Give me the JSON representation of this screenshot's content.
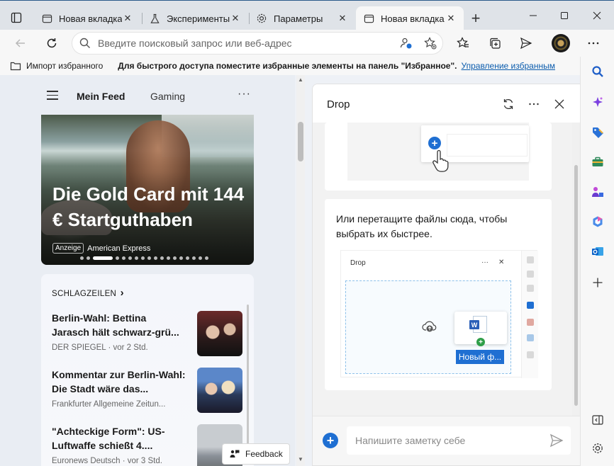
{
  "tabs": [
    {
      "label": "Новая вкладка",
      "icon": "newtab-icon"
    },
    {
      "label": "Эксперименты",
      "icon": "flask-icon"
    },
    {
      "label": "Параметры",
      "icon": "gear-icon"
    },
    {
      "label": "Новая вкладка",
      "icon": "newtab-icon",
      "active": true
    }
  ],
  "address": {
    "placeholder": "Введите поисковый запрос или веб-адрес"
  },
  "favorites_bar": {
    "import_label": "Импорт избранного",
    "hint": "Для быстрого доступа поместите избранные элементы на панель \"Избранное\".",
    "manage_link": "Управление избранным"
  },
  "feed": {
    "tabs": [
      "Mein Feed",
      "Gaming"
    ],
    "more": "···",
    "hero": {
      "title": "Die Gold Card mit 144 € Startguthaben",
      "ad_badge": "Anzeige",
      "source": "American Express"
    },
    "headlines_label": "SCHLAGZEILEN",
    "headlines_chevron": "›",
    "news": [
      {
        "title": "Berlin-Wahl: Bettina Jarasch hält schwarz-grü...",
        "meta": "DER SPIEGEL · vor 2 Std."
      },
      {
        "title": "Kommentar zur Berlin-Wahl: Die Stadt wäre das...",
        "meta": "Frankfurter Allgemeine Zeitun..."
      },
      {
        "title": "\"Achteckige Form\": US-Luftwaffe schießt 4....",
        "meta": "Euronews Deutsch · vor 3 Std."
      }
    ],
    "feedback_label": "Feedback"
  },
  "drop": {
    "title": "Drop",
    "drag_text": "Или перетащите файлы сюда, чтобы выбрать их быстрее.",
    "mini_title": "Drop",
    "mini_more": "···",
    "mini_close": "✕",
    "mini_file_name": "Новый ф...",
    "note_placeholder": "Напишите заметку себе"
  },
  "colors": {
    "accent": "#1f6fd2",
    "link": "#0b5cad"
  }
}
